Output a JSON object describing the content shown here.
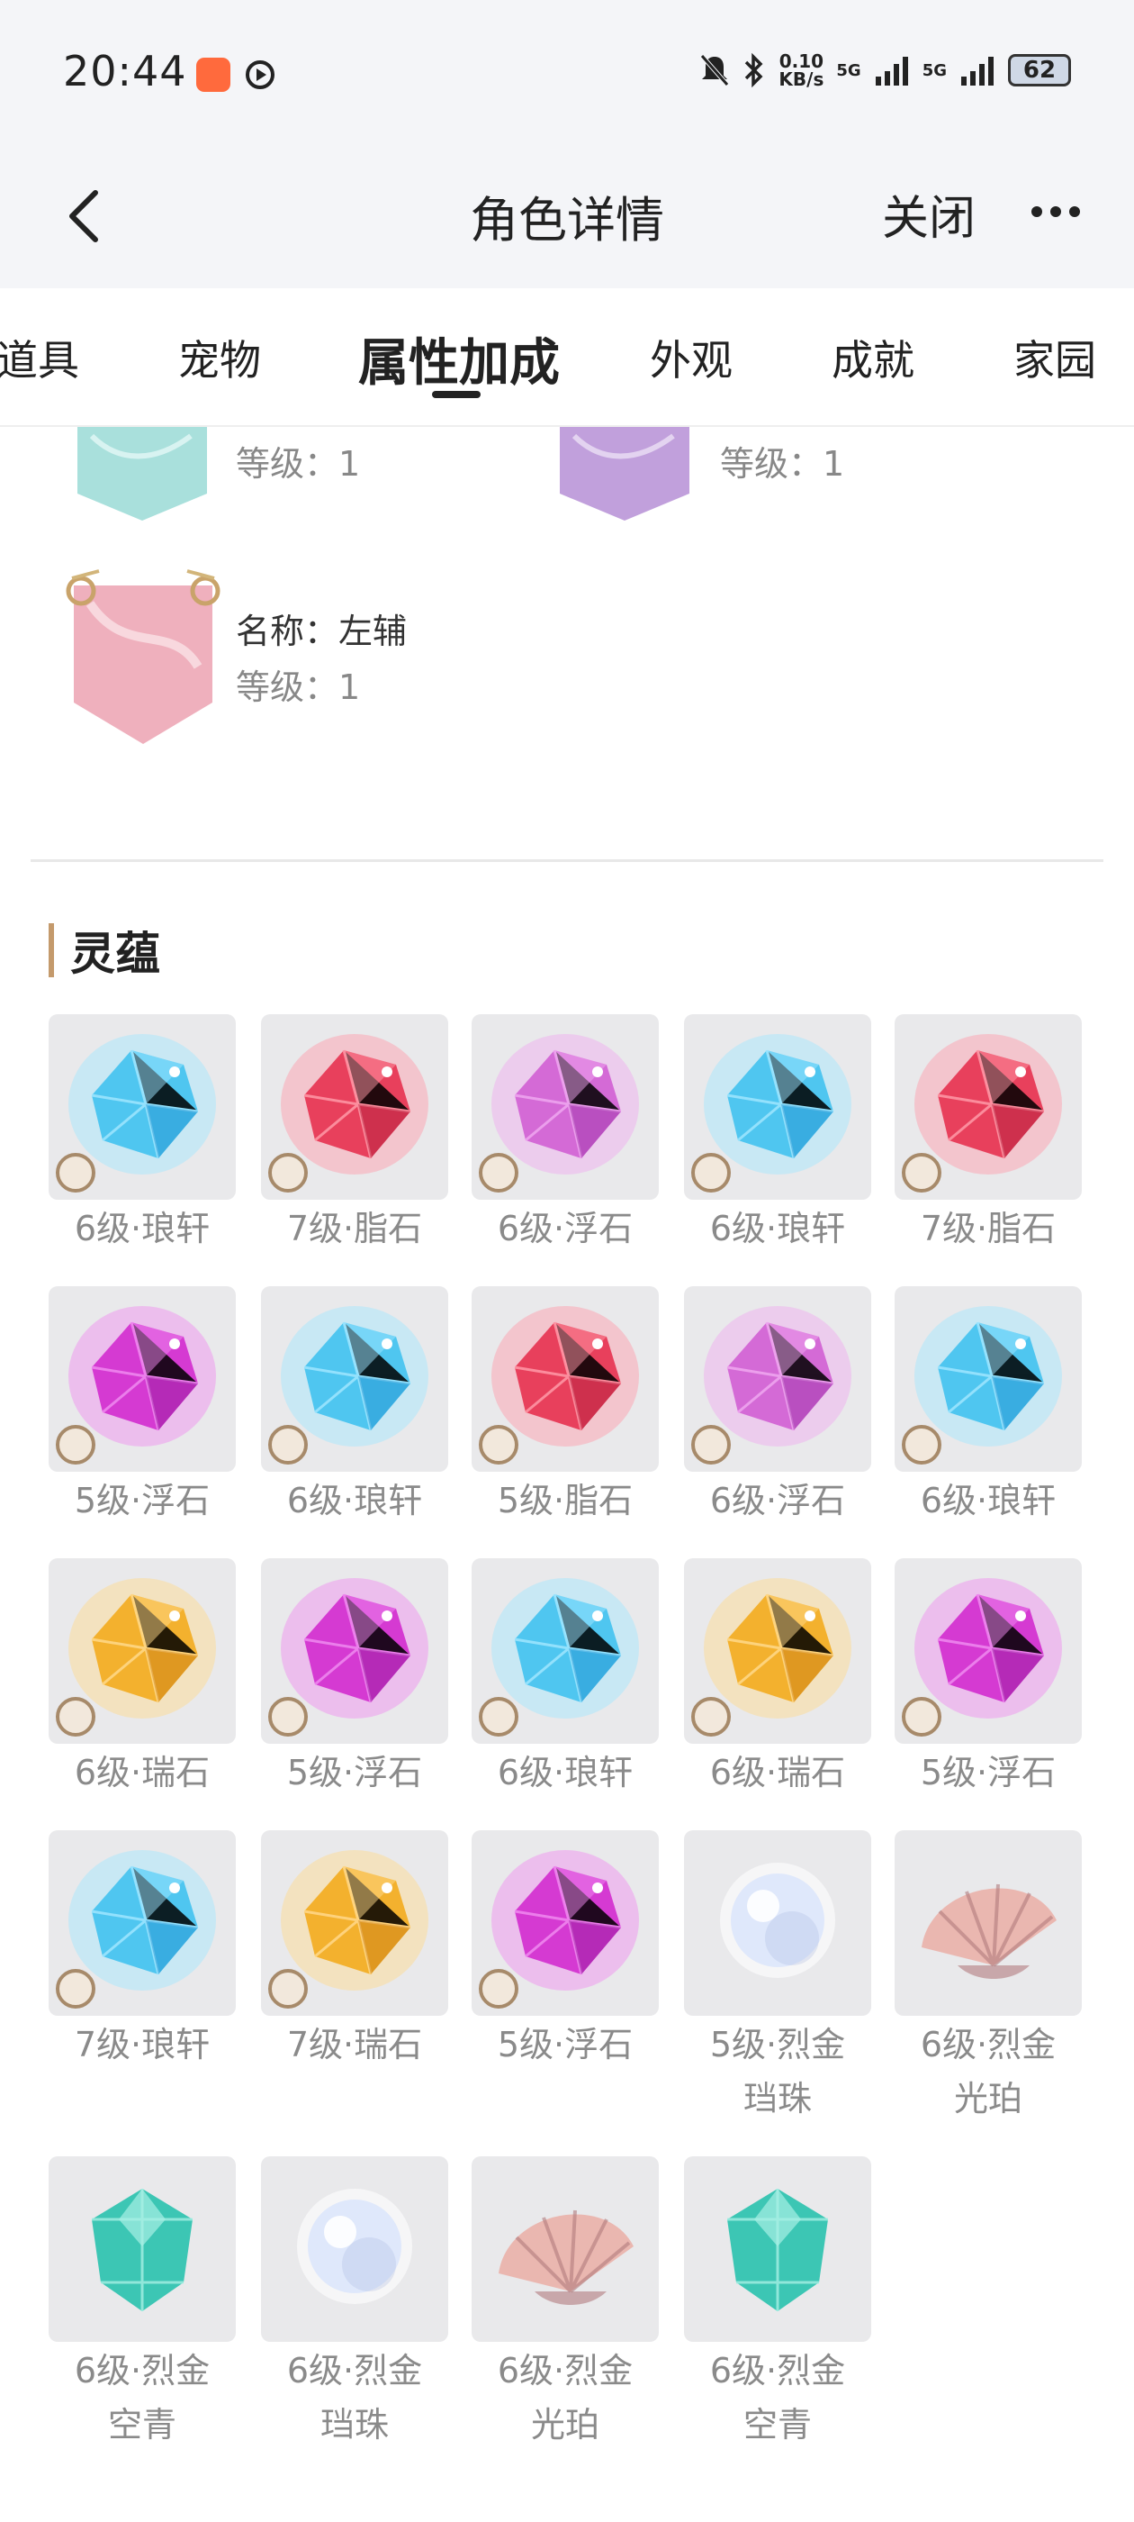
{
  "status_bar": {
    "time": "20:44",
    "net_speed_value": "0.10",
    "net_speed_unit": "KB/s",
    "signal1": "5G",
    "signal2": "5G",
    "battery": "62"
  },
  "header": {
    "title": "角色详情",
    "close_label": "关闭"
  },
  "tabs": [
    {
      "label": "道具"
    },
    {
      "label": "宠物"
    },
    {
      "label": "属性加成",
      "active": true
    },
    {
      "label": "外观"
    },
    {
      "label": "成就"
    },
    {
      "label": "家园"
    }
  ],
  "badges": [
    {
      "level_label": "等级：1",
      "color": "#9fd8d4"
    },
    {
      "level_label": "等级：1",
      "color": "#b996d6"
    },
    {
      "name_label": "名称：左辅",
      "level_label": "等级：1",
      "color": "#eaa6b4"
    }
  ],
  "section": {
    "title": "灵蕴"
  },
  "gems": [
    {
      "line1": "6级·琅轩",
      "type": "blue"
    },
    {
      "line1": "7级·脂石",
      "type": "red"
    },
    {
      "line1": "6级·浮石",
      "type": "purple"
    },
    {
      "line1": "6级·琅轩",
      "type": "blue"
    },
    {
      "line1": "7级·脂石",
      "type": "red"
    },
    {
      "line1": "5级·浮石",
      "type": "magenta"
    },
    {
      "line1": "6级·琅轩",
      "type": "blue"
    },
    {
      "line1": "5级·脂石",
      "type": "red"
    },
    {
      "line1": "6级·浮石",
      "type": "purple"
    },
    {
      "line1": "6级·琅轩",
      "type": "blue"
    },
    {
      "line1": "6级·瑞石",
      "type": "amber"
    },
    {
      "line1": "5级·浮石",
      "type": "magenta"
    },
    {
      "line1": "6级·琅轩",
      "type": "blue"
    },
    {
      "line1": "6级·瑞石",
      "type": "amber"
    },
    {
      "line1": "5级·浮石",
      "type": "magenta"
    },
    {
      "line1": "7级·琅轩",
      "type": "blue"
    },
    {
      "line1": "7级·瑞石",
      "type": "amber"
    },
    {
      "line1": "5级·浮石",
      "type": "magenta"
    },
    {
      "line1": "5级·烈金",
      "line2": "珰珠",
      "type": "pearl"
    },
    {
      "line1": "6级·烈金",
      "line2": "光珀",
      "type": "shell"
    },
    {
      "line1": "6级·烈金",
      "line2": "空青",
      "type": "teal"
    },
    {
      "line1": "6级·烈金",
      "line2": "珰珠",
      "type": "pearl"
    },
    {
      "line1": "6级·烈金",
      "line2": "光珀",
      "type": "shell"
    },
    {
      "line1": "6级·烈金",
      "line2": "空青",
      "type": "teal"
    }
  ],
  "colors": {
    "header_bg": "#f4f5f8",
    "accent_bar": "#c49a6c",
    "tile_bg": "#e9e9eb",
    "label_gray": "#8a8a8a"
  }
}
